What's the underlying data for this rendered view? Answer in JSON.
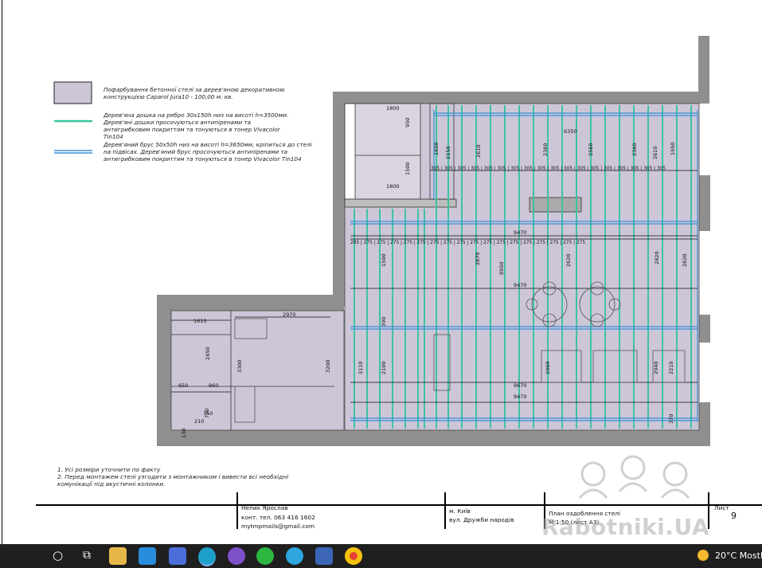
{
  "legend": {
    "fill_text": "Пофарбування бетонної стелі за дерев'яною декоративною конструкцією Caparol Jura10 - 100,00 м. кв.",
    "green_text": "Дерев'яна дошка на ребро 30х150h низ на висоті h=3500мм. Дерев'яні дошки просочуються антипіренами та антигрибковим покриттям та тонуються в тонер Vivacolor Tin104",
    "blue_text": "Дерев'яний брус 50х50h низ на висоті h=3650мм, кріпиться до стелі на підвісах. Дерев'яний брус просочуються антипіренами та антигрибковим покриттям та тонуються в тонер Vivacolor Tin104"
  },
  "notes": [
    "1.  Усі розміри уточнити по факту",
    "2.  Перед монтажем стелі узгодити з монтажником і вивести всі необхідні комунікації під акустичні колонки."
  ],
  "title_block": {
    "author": "Непик Ярослав",
    "phone": "конт. тел. 063 416 1602",
    "email": "mytmpmails@gmail.com",
    "city": "м. Київ",
    "street": "вул. Дружби народів",
    "plan_title": "План оздоблення стелі",
    "scale": "М 1:50 (лист А3)",
    "sheet_label": "Лист",
    "sheet_number": "9"
  },
  "dims": {
    "d1800a": "1800",
    "d1800b": "1800",
    "d950": "950",
    "d1500": "1500",
    "d6350": "6350",
    "d9470a": "9470",
    "d9470b": "9470",
    "d9470c": "9470",
    "d9670": "9670",
    "d2970": "2970",
    "d1610": "1610",
    "d2450": "2450",
    "d3300": "3300",
    "d3200": "3200",
    "d650": "650",
    "d960": "960",
    "d750a": "750",
    "d750b": "750",
    "d130": "130",
    "d210": "210",
    "d2610": "2610",
    "d2360a": "2360",
    "d2560": "2560",
    "d2360b": "2360",
    "d2610b": "2610",
    "d1950": "1950",
    "d2870": "2870",
    "d8950": "8950",
    "d2620a": "2620",
    "d2620b": "2620",
    "d2820": "2820",
    "d2960": "2960",
    "d2940": "2940",
    "d2210": "2210",
    "d3110": "3110",
    "d2100": "2100",
    "d1650": "1650",
    "d2150": "2150",
    "d1500b": "1500",
    "d390": "390",
    "d370": "370",
    "row305": "305 | 305 | 305 | 305 | 305 | 305 | 305 | 305 | 305 | 305 | 305 | 305 | 305 | 305 | 305 | 305 | 305 | 305",
    "row275": "285 | 275 | 275 | 275 | 275 | 275 | 275 | 275 | 275 | 275 | 275 | 275 | 275 | 275 | 275 | 275 | 275 | 275"
  },
  "watermark": "Rabotniki.UA",
  "taskbar": {
    "weather_temp": "20°C",
    "weather_text": "Mostly"
  },
  "colors": {
    "legend_fill": "#cdc6d8",
    "green_board": "#3fc3a0",
    "blue_beam": "#3a8fd6",
    "wall": "#8f8f8f",
    "taskbar": "#1f1f1f"
  }
}
